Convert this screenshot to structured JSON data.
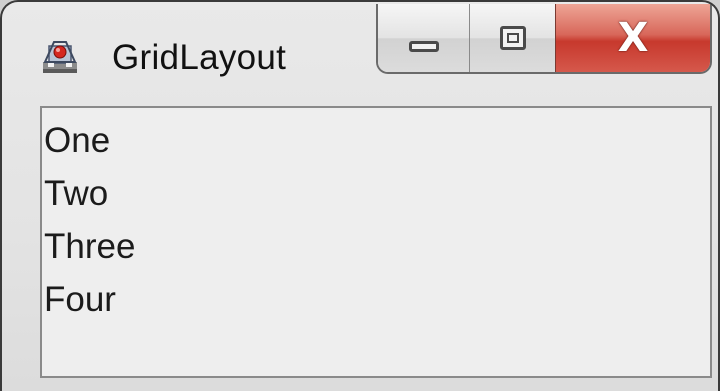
{
  "window": {
    "title": "GridLayout",
    "icon": "java-app-icon",
    "caption_buttons": {
      "minimize": "minimize-icon",
      "maximize": "maximize-icon",
      "close": "X"
    }
  },
  "content": {
    "labels": [
      "One",
      "Two",
      "Three",
      "Four"
    ]
  },
  "colors": {
    "close_button": "#c7392d",
    "panel_background": "#eeeeee"
  }
}
